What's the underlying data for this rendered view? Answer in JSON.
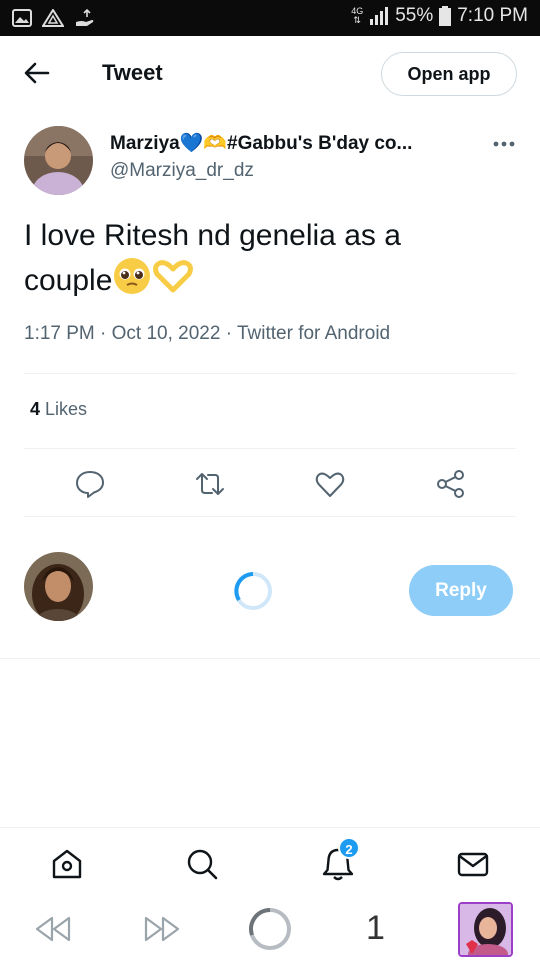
{
  "status_bar": {
    "network": "4G",
    "battery": "55%",
    "time": "7:10 PM"
  },
  "header": {
    "title": "Tweet",
    "open_app_label": "Open app"
  },
  "tweet": {
    "author_name": "Marziya💙🫶#Gabbu's B'day co...",
    "author_handle": "@Marziya_dr_dz",
    "text_line1": "I love Ritesh nd genelia as a",
    "text_line2": "couple",
    "timestamp": "1:17 PM · Oct 10, 2022 · Twitter for Android",
    "likes_count": "4",
    "likes_label": "Likes"
  },
  "actions": {
    "icons": [
      "reply-icon",
      "retweet-icon",
      "like-icon",
      "share-icon"
    ]
  },
  "reply": {
    "button_label": "Reply"
  },
  "bottom_nav": {
    "icons": [
      "home-icon",
      "search-icon",
      "notifications-icon",
      "messages-icon"
    ],
    "notification_badge": "2"
  },
  "browser_toolbar": {
    "tab_count": "1"
  },
  "colors": {
    "accent": "#1d9bf0",
    "reply_button": "#8ecdf8",
    "secondary_text": "#536471",
    "divider": "#eff3f4"
  }
}
